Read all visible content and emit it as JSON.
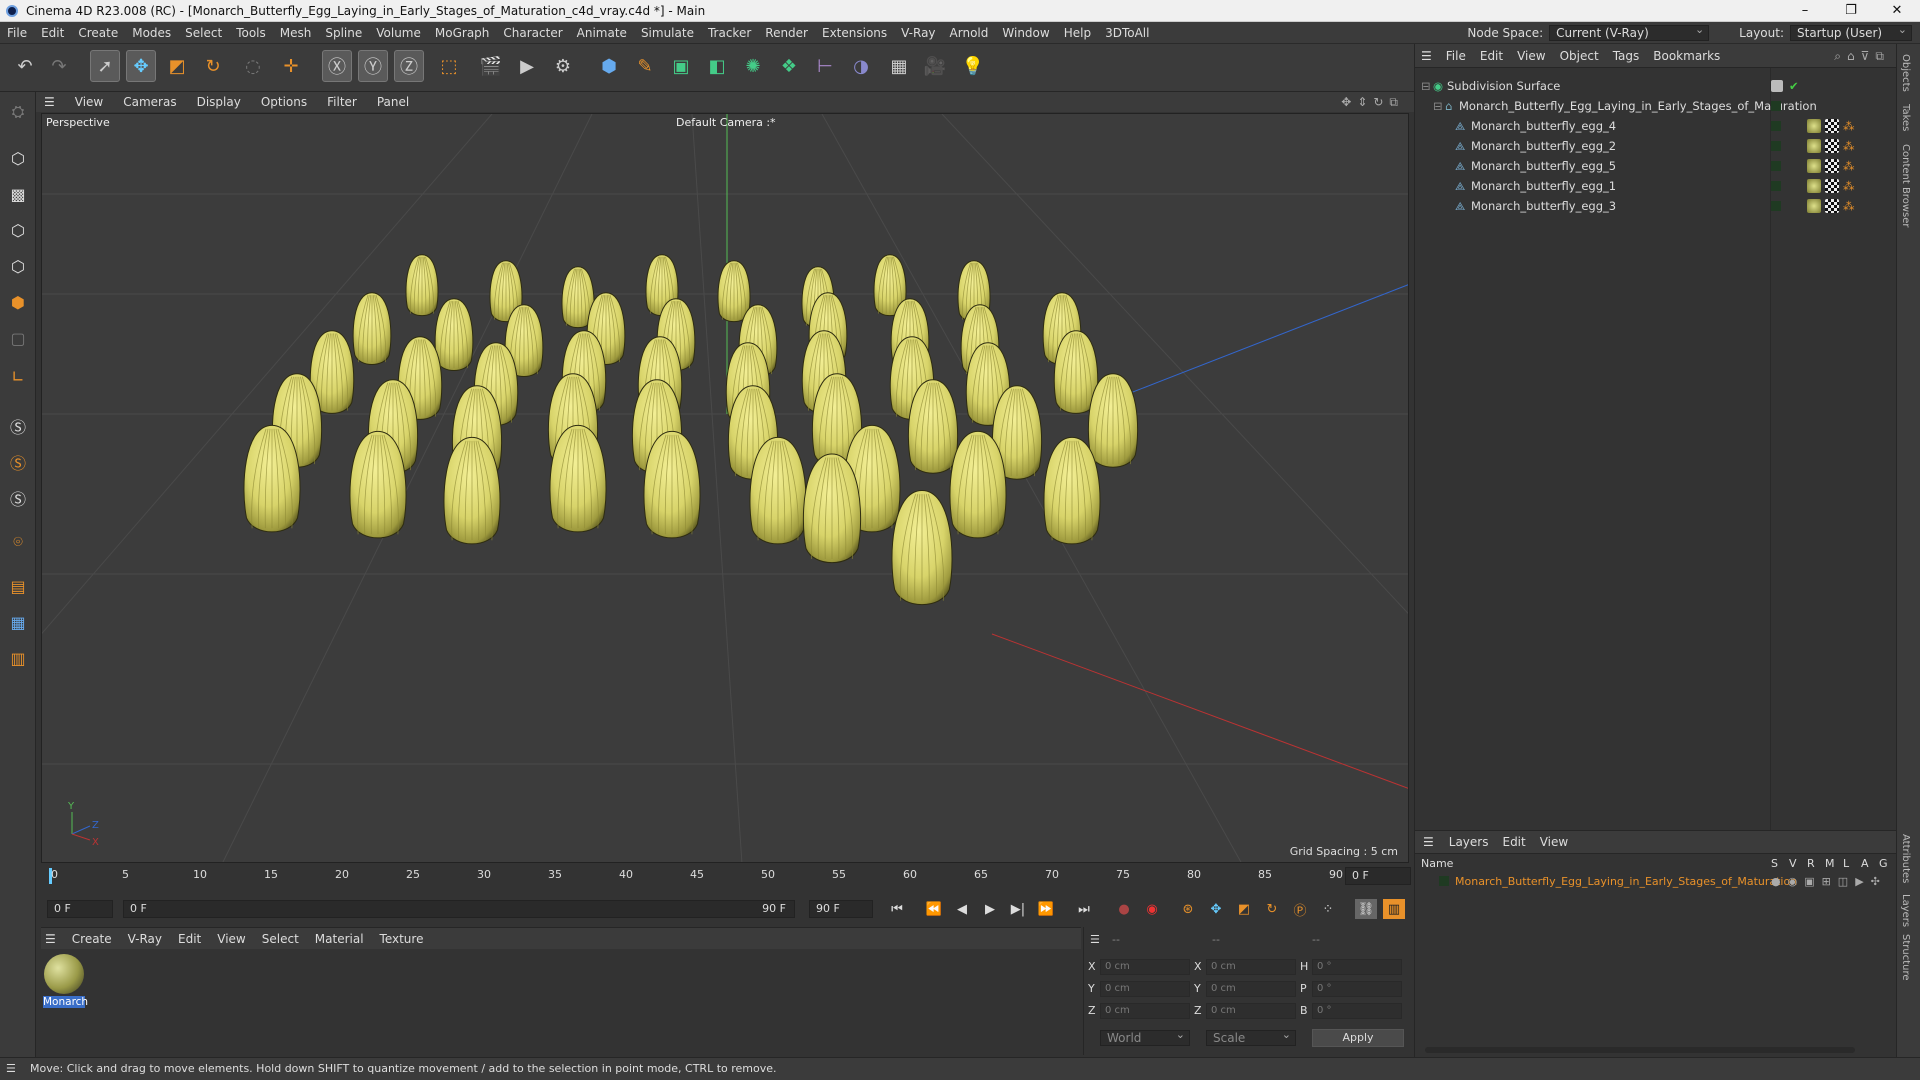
{
  "window": {
    "title": "Cinema 4D R23.008 (RC) - [Monarch_Butterfly_Egg_Laying_in_Early_Stages_of_Maturation_c4d_vray.c4d *] - Main",
    "controls": [
      "–",
      "❐",
      "✕"
    ]
  },
  "menubar": {
    "items": [
      "File",
      "Edit",
      "Create",
      "Modes",
      "Select",
      "Tools",
      "Mesh",
      "Spline",
      "Volume",
      "MoGraph",
      "Character",
      "Animate",
      "Simulate",
      "Tracker",
      "Render",
      "Extensions",
      "V-Ray",
      "Arnold",
      "Window",
      "Help",
      "3DToAll"
    ],
    "node_space_label": "Node Space:",
    "node_space_value": "Current (V-Ray)",
    "layout_label": "Layout:",
    "layout_value": "Startup (User)"
  },
  "viewport": {
    "menu": [
      "View",
      "Cameras",
      "Display",
      "Options",
      "Filter",
      "Panel"
    ],
    "label": "Perspective",
    "camera": "Default Camera",
    "grid_spacing": "Grid Spacing : 5 cm"
  },
  "timeline": {
    "ticks": [
      "0",
      "5",
      "10",
      "15",
      "20",
      "25",
      "30",
      "35",
      "40",
      "45",
      "50",
      "55",
      "60",
      "65",
      "70",
      "75",
      "80",
      "85",
      "90"
    ],
    "current_frame_right": "0 F",
    "start": "0 F",
    "range_start": "0 F",
    "range_end": "90 F",
    "end": "90 F"
  },
  "material_panel": {
    "menu": [
      "Create",
      "V-Ray",
      "Edit",
      "View",
      "Select",
      "Material",
      "Texture"
    ],
    "material_name": "Monarch"
  },
  "coords": {
    "header": [
      "--",
      "--",
      "--"
    ],
    "rows": [
      {
        "a": "X",
        "av": "0 cm",
        "b": "X",
        "bv": "0 cm",
        "c": "H",
        "cv": "0 °"
      },
      {
        "a": "Y",
        "av": "0 cm",
        "b": "Y",
        "bv": "0 cm",
        "c": "P",
        "cv": "0 °"
      },
      {
        "a": "Z",
        "av": "0 cm",
        "b": "Z",
        "bv": "0 cm",
        "c": "B",
        "cv": "0 °"
      }
    ],
    "world": "World",
    "scale": "Scale",
    "apply": "Apply"
  },
  "object_manager": {
    "menu": [
      "File",
      "Edit",
      "View",
      "Object",
      "Tags",
      "Bookmarks"
    ],
    "objects": [
      {
        "name": "Subdivision Surface",
        "level": 0
      },
      {
        "name": "Monarch_Butterfly_Egg_Laying_in_Early_Stages_of_Maturation",
        "level": 1
      },
      {
        "name": "Monarch_butterfly_egg_4",
        "level": 2
      },
      {
        "name": "Monarch_butterfly_egg_2",
        "level": 2
      },
      {
        "name": "Monarch_butterfly_egg_5",
        "level": 2
      },
      {
        "name": "Monarch_butterfly_egg_1",
        "level": 2
      },
      {
        "name": "Monarch_butterfly_egg_3",
        "level": 2
      }
    ]
  },
  "layers": {
    "menu": [
      "Layers",
      "Edit",
      "View"
    ],
    "name_header": "Name",
    "columns": [
      "S",
      "V",
      "R",
      "M",
      "L",
      "A",
      "G"
    ],
    "layer_name": "Monarch_Butterfly_Egg_Laying_in_Early_Stages_of_Maturation"
  },
  "side_tabs": [
    "Objects",
    "Takes",
    "Content Browser",
    "Attributes",
    "Layers",
    "Structure"
  ],
  "status": "Move: Click and drag to move elements. Hold down SHIFT to quantize movement / add to the selection in point mode, CTRL to remove.",
  "colors": {
    "egg": "#d8d46a",
    "accent": "#e8912a",
    "axis_red": "#b33",
    "axis_green": "#5b5",
    "axis_blue": "#36c"
  }
}
